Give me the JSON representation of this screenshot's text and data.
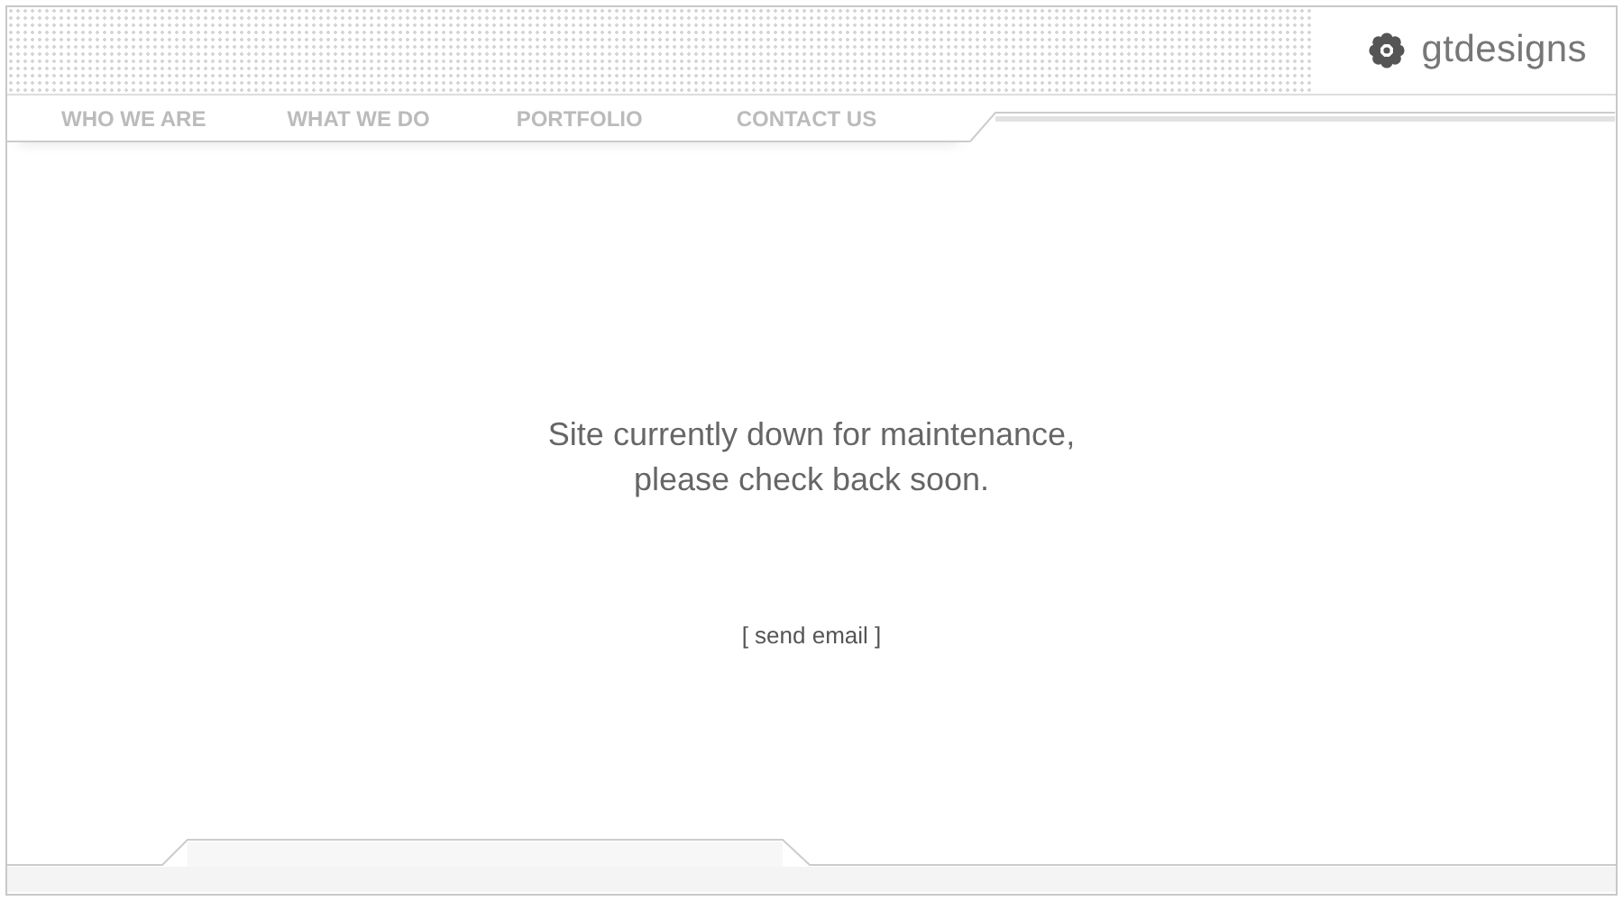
{
  "logo": {
    "text": "gtdesigns"
  },
  "nav": [
    {
      "label": "WHO WE ARE"
    },
    {
      "label": "WHAT WE DO"
    },
    {
      "label": "PORTFOLIO"
    },
    {
      "label": "CONTACT US"
    }
  ],
  "message": {
    "lines": [
      "Site currently down for maintenance,",
      "please check back soon."
    ]
  },
  "email_link": "[ send email ]"
}
